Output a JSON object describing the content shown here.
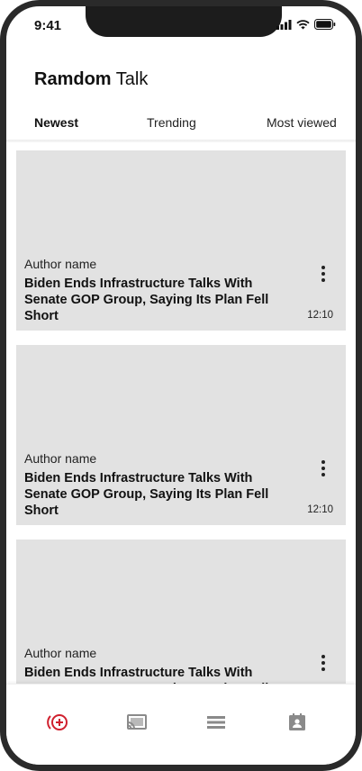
{
  "status_bar": {
    "time": "9:41"
  },
  "app": {
    "title_bold": "Ramdom",
    "title_rest": "Talk"
  },
  "tabs": [
    {
      "label": "Newest",
      "active": true
    },
    {
      "label": "Trending",
      "active": false
    },
    {
      "label": "Most viewed",
      "active": false
    }
  ],
  "feed": [
    {
      "author": "Author name",
      "headline": "Biden Ends Infrastructure Talks With Senate GOP Group, Saying Its Plan Fell Short",
      "time": "12:10"
    },
    {
      "author": "Author name",
      "headline": "Biden Ends Infrastructure Talks With Senate GOP Group, Saying Its Plan Fell Short",
      "time": "12:10"
    },
    {
      "author": "Author name",
      "headline": "Biden Ends Infrastructure Talks With Senate GOP Group, Saying Its Plan Fell Short",
      "time": ""
    }
  ],
  "bottom_nav": [
    {
      "icon": "live-add-icon",
      "active": true
    },
    {
      "icon": "cast-icon",
      "active": false
    },
    {
      "icon": "list-icon",
      "active": false
    },
    {
      "icon": "contact-book-icon",
      "active": false
    }
  ],
  "colors": {
    "accent": "#d0202e",
    "card_bg": "#e2e2e2",
    "icon_inactive": "#8a8a8a"
  }
}
